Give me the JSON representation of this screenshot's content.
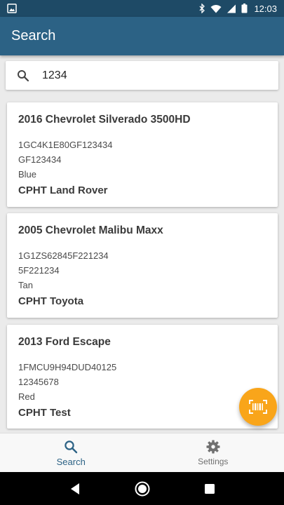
{
  "status_bar": {
    "time": "12:03"
  },
  "app_bar": {
    "title": "Search"
  },
  "search": {
    "value": "1234"
  },
  "results": [
    {
      "title": "2016 Chevrolet Silverado 3500HD",
      "vin": "1GC4K1E80GF123434",
      "stock": "GF123434",
      "color": "Blue",
      "dealer": "CPHT Land Rover"
    },
    {
      "title": "2005 Chevrolet Malibu Maxx",
      "vin": "1G1ZS62845F221234",
      "stock": "5F221234",
      "color": "Tan",
      "dealer": "CPHT Toyota"
    },
    {
      "title": "2013 Ford Escape",
      "vin": "1FMCU9H94DUD40125",
      "stock": "12345678",
      "color": "Red",
      "dealer": "CPHT Test"
    }
  ],
  "bottom_nav": {
    "search_label": "Search",
    "settings_label": "Settings"
  },
  "colors": {
    "primary": "#2c6285",
    "status_bar": "#1e4a66",
    "accent": "#f9a51a"
  },
  "icons": {
    "fab": "barcode-icon",
    "search": "search-icon",
    "settings": "gear-icon"
  }
}
